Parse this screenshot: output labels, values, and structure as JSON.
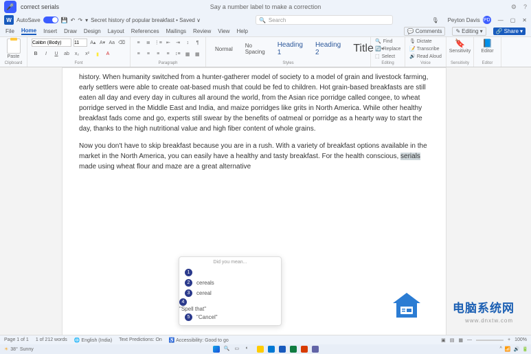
{
  "titlebar": {
    "voice_cmd": "correct serials",
    "hint": "Say a number label to make a correction"
  },
  "header": {
    "autosave": "AutoSave",
    "doc_name": "Secret history of popular breakfast • Saved ∨",
    "search_placeholder": "Search",
    "user_name": "Peyton Davis",
    "user_initials": "PD"
  },
  "tabs": {
    "items": [
      "File",
      "Home",
      "Insert",
      "Draw",
      "Design",
      "Layout",
      "References",
      "Mailings",
      "Review",
      "View",
      "Help"
    ],
    "active": 1,
    "comments": "Comments",
    "editing": "Editing",
    "share": "Share"
  },
  "ribbon": {
    "clipboard": {
      "paste": "Paste",
      "label": "Clipboard"
    },
    "font": {
      "name": "Calibri (Body)",
      "size": "11",
      "label": "Font"
    },
    "paragraph": {
      "label": "Paragraph"
    },
    "styles": {
      "normal": "Normal",
      "nospacing": "No Spacing",
      "h1": "Heading 1",
      "h2": "Heading 2",
      "title": "Title",
      "label": "Styles"
    },
    "editing_grp": {
      "find": "Find",
      "replace": "Replace",
      "select": "Select",
      "label": "Editing"
    },
    "voice": {
      "dictate": "Dictate",
      "transcribe": "Transcribe",
      "readaloud": "Read Aloud",
      "label": "Voice"
    },
    "sensitivity": {
      "btn": "Sensitivity",
      "label": "Sensitivity"
    },
    "editor": {
      "btn": "Editor",
      "label": "Editor"
    }
  },
  "document": {
    "para1": "history. When humanity switched from a hunter-gatherer model of society to a model of grain and livestock farming, early settlers were able to create oat-based mush that could be fed to children. Hot grain-based breakfasts are still eaten all day and every day in cultures all around the world, from the Asian rice porridge called congee, to wheat porridge served in the Middle East and India, and maize porridges like grits in North America. While other healthy breakfast fads come and go, experts still swear by the benefits of oatmeal or porridge as a hearty way to start the day, thanks to the high nutritional value and high fiber content of whole grains.",
    "para2_pre": "Now you don't have to skip breakfast because you are in a rush. With a variety of breakfast options available in the market in the North America, you can easily have a healthy and tasty breakfast. For the health conscious, ",
    "para2_hl": "serials",
    "para2_post": " made using wheat flour and maze are a great alternative"
  },
  "suggestion": {
    "title": "Did you mean...",
    "items": [
      "",
      "cereals",
      "cereal",
      "\"Spell that\"",
      "\"Cancel\""
    ]
  },
  "status": {
    "page": "Page 1 of 1",
    "words": "1 of 212 words",
    "lang": "English (India)",
    "pred": "Text Predictions: On",
    "acc": "Accessibility: Good to go",
    "zoom": "100%"
  },
  "taskbar": {
    "temp": "38°",
    "weather": "Sunny"
  },
  "watermark": {
    "text": "电脑系统网",
    "url": "www.dnxtw.com"
  }
}
